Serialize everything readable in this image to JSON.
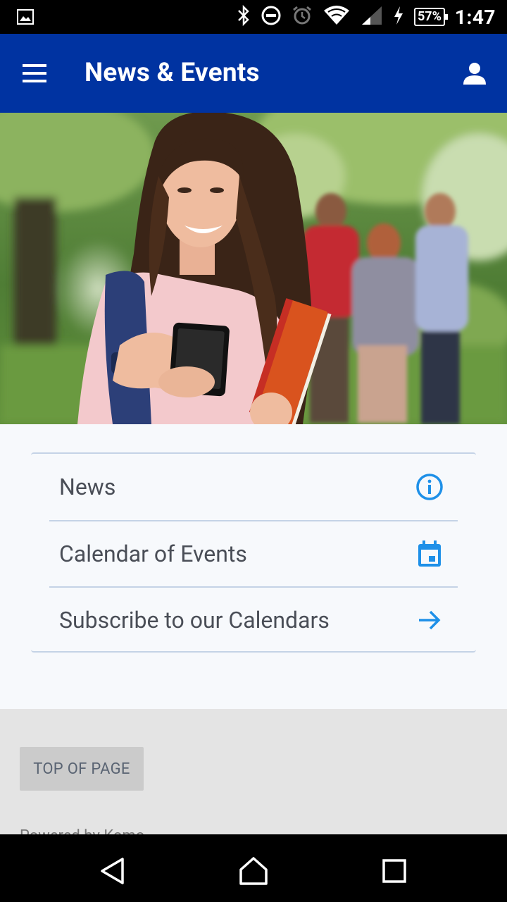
{
  "status_bar": {
    "battery": "57%",
    "time": "1:47",
    "icons": [
      "gallery-notification-icon",
      "bluetooth-icon",
      "do-not-disturb-icon",
      "alarm-icon",
      "wifi-icon",
      "cell-signal-icon",
      "charging-icon",
      "battery-icon"
    ]
  },
  "app_bar": {
    "title": "News & Events",
    "left_icon": "hamburger-menu-icon",
    "right_icon": "profile-icon",
    "color": "#0033a1"
  },
  "hero": {
    "alt": "Student smiling at phone holding an orange notebook"
  },
  "menu": {
    "items": [
      {
        "label": "News",
        "icon": "info-icon"
      },
      {
        "label": "Calendar of Events",
        "icon": "calendar-icon"
      },
      {
        "label": "Subscribe to our Calendars",
        "icon": "arrow-right-icon"
      }
    ],
    "icon_color": "#1e90e8"
  },
  "footer": {
    "top_button": "TOP OF PAGE",
    "powered_by": "Powered by Komo"
  },
  "nav_bar": {
    "icons": [
      "back-icon",
      "home-icon",
      "recents-icon"
    ]
  }
}
